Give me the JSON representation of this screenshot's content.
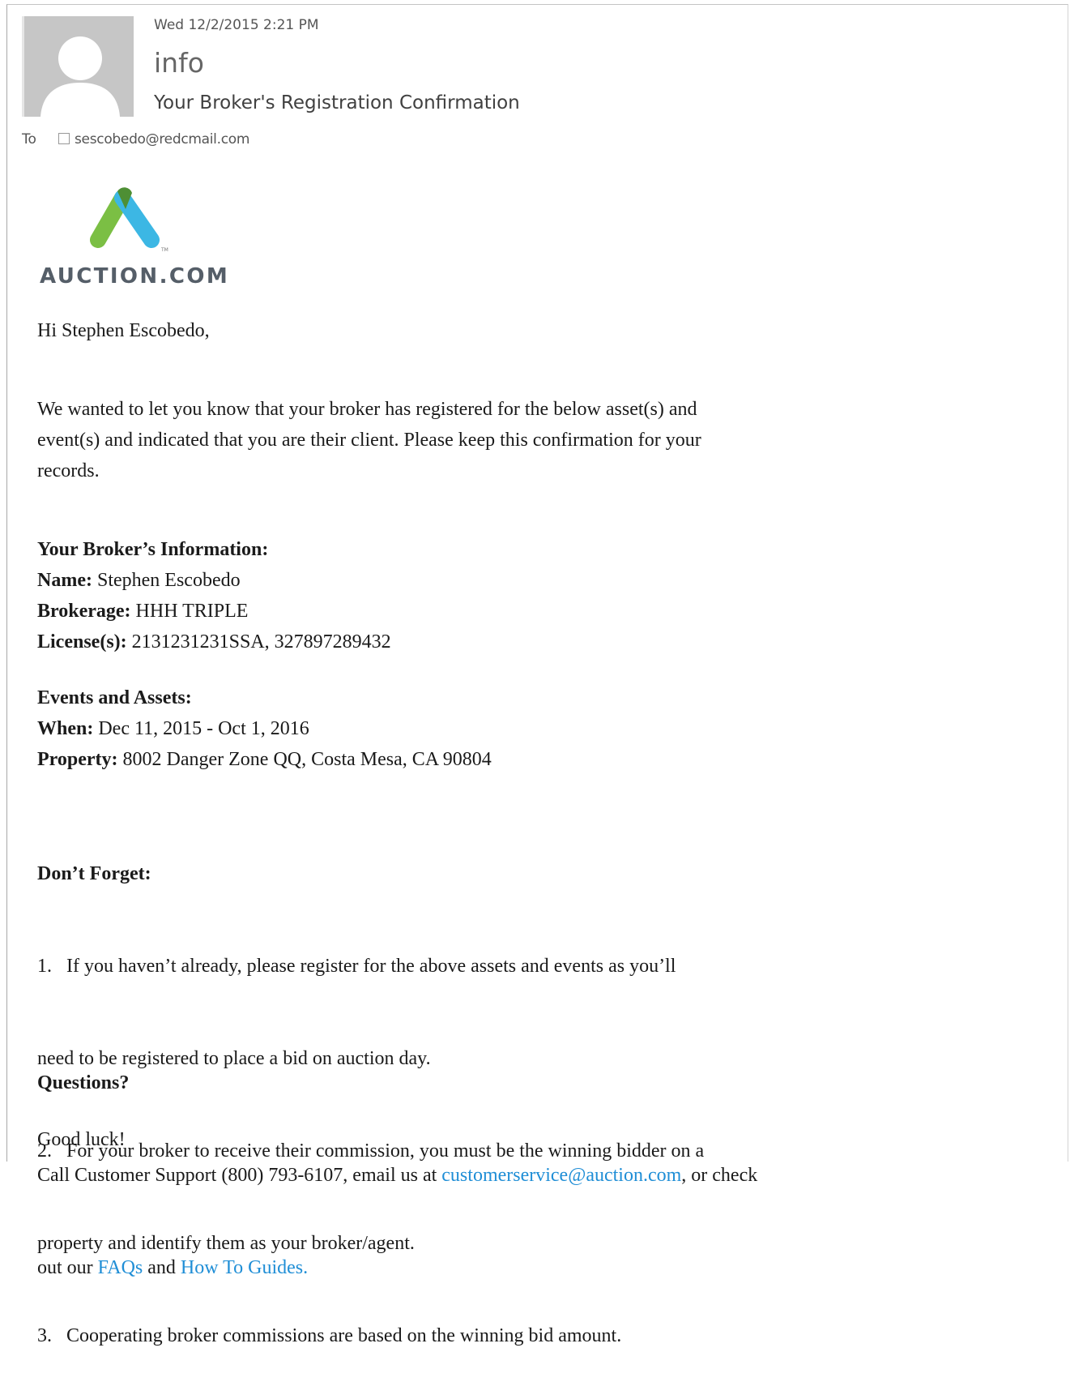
{
  "header": {
    "date": "Wed 12/2/2015 2:21 PM",
    "sender": "info",
    "subject": "Your Broker's Registration Confirmation",
    "to_label": "To",
    "to_email": "sescobedo@redcmail.com"
  },
  "logo": {
    "text": "AUCTION.COM",
    "trademark": "TM",
    "colors": {
      "green": "#7bbf44",
      "blue": "#3cb7e4",
      "dark_green": "#4e8f34",
      "text": "#555e68"
    }
  },
  "greeting": "Hi Stephen Escobedo,",
  "intro_lines": [
    "We wanted to let you know that your broker has registered for the below asset(s) and",
    "event(s) and indicated that you are their client. Please keep this confirmation for your",
    "records."
  ],
  "broker_info": {
    "heading": "Your Broker’s Information:",
    "name_label": "Name:",
    "name_value": " Stephen Escobedo",
    "brokerage_label": "Brokerage:",
    "brokerage_value": " HHH TRIPLE",
    "licenses_label": "License(s):",
    "licenses_value": " 2131231231SSA, 327897289432"
  },
  "events": {
    "heading": "Events and Assets:",
    "when_label": "When:",
    "when_value": " Dec 11, 2015 - Oct 1, 2016",
    "property_label": "Property:",
    "property_value": " 8002 Danger Zone QQ, Costa Mesa, CA 90804"
  },
  "dont_forget": {
    "heading": "Don’t Forget:",
    "lines": [
      "1.   If you haven’t already, please register for the above assets and events as you’ll",
      "need to be registered to place a bid on auction day.",
      "2.   For your broker to receive their commission, you must be the winning bidder on a",
      "property and identify them as your broker/agent.",
      "3.   Cooperating broker commissions are based on the winning bid amount."
    ]
  },
  "questions": {
    "heading": "Questions?",
    "line1_prefix": "Call Customer Support (800) 793-6107, email us at ",
    "email_link": "customerservice@auction.com",
    "line1_suffix": ", or check",
    "line2_prefix": "out our ",
    "faq_link": "FAQs",
    "line2_mid": " and ",
    "guides_link": "How To Guides."
  },
  "closing": "Good luck!"
}
